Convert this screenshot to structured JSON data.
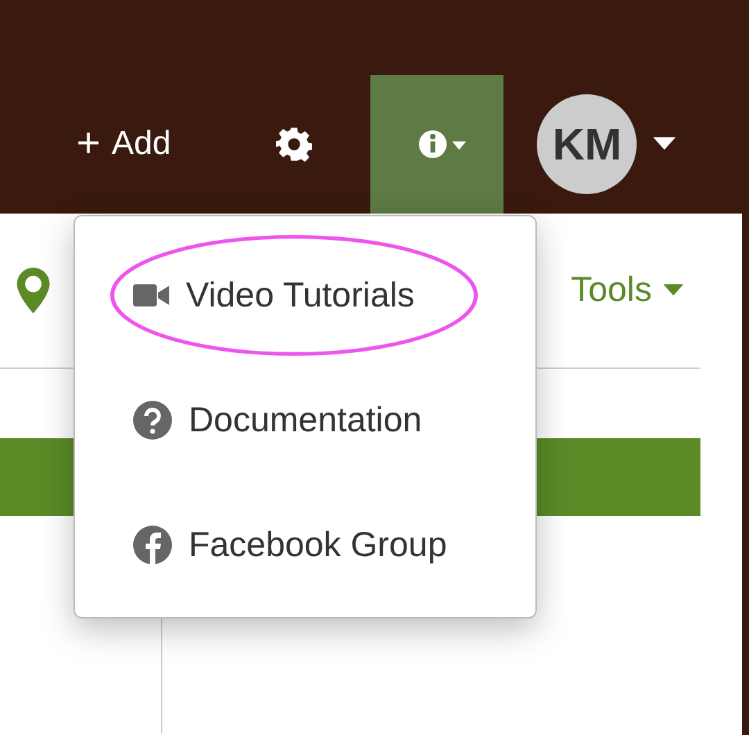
{
  "top_bar": {
    "add_button": {
      "icon": "+",
      "label": "Add"
    },
    "help_button": {
      "selected": true
    },
    "avatar": {
      "initials": "KM"
    }
  },
  "toolbar": {
    "tools_menu": "Tools"
  },
  "help_menu": {
    "items": [
      {
        "kind": "video",
        "label": "Video Tutorials",
        "circled": true
      },
      {
        "kind": "question",
        "label": "Documentation",
        "circled": false
      },
      {
        "kind": "facebook",
        "label": "Facebook Group",
        "circled": false
      }
    ]
  }
}
